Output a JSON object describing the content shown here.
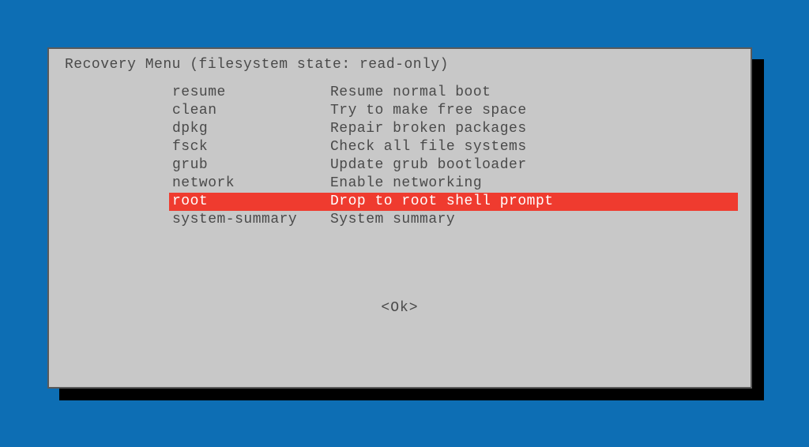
{
  "title": "Recovery Menu (filesystem state: read-only)",
  "menu": [
    {
      "key": "resume",
      "desc": "Resume normal boot",
      "selected": false
    },
    {
      "key": "clean",
      "desc": "Try to make free space",
      "selected": false
    },
    {
      "key": "dpkg",
      "desc": "Repair broken packages",
      "selected": false
    },
    {
      "key": "fsck",
      "desc": "Check all file systems",
      "selected": false
    },
    {
      "key": "grub",
      "desc": "Update grub bootloader",
      "selected": false
    },
    {
      "key": "network",
      "desc": "Enable networking",
      "selected": false
    },
    {
      "key": "root",
      "desc": "Drop to root shell prompt",
      "selected": true
    },
    {
      "key": "system-summary",
      "desc": "System summary",
      "selected": false
    }
  ],
  "ok_label": "<Ok>"
}
